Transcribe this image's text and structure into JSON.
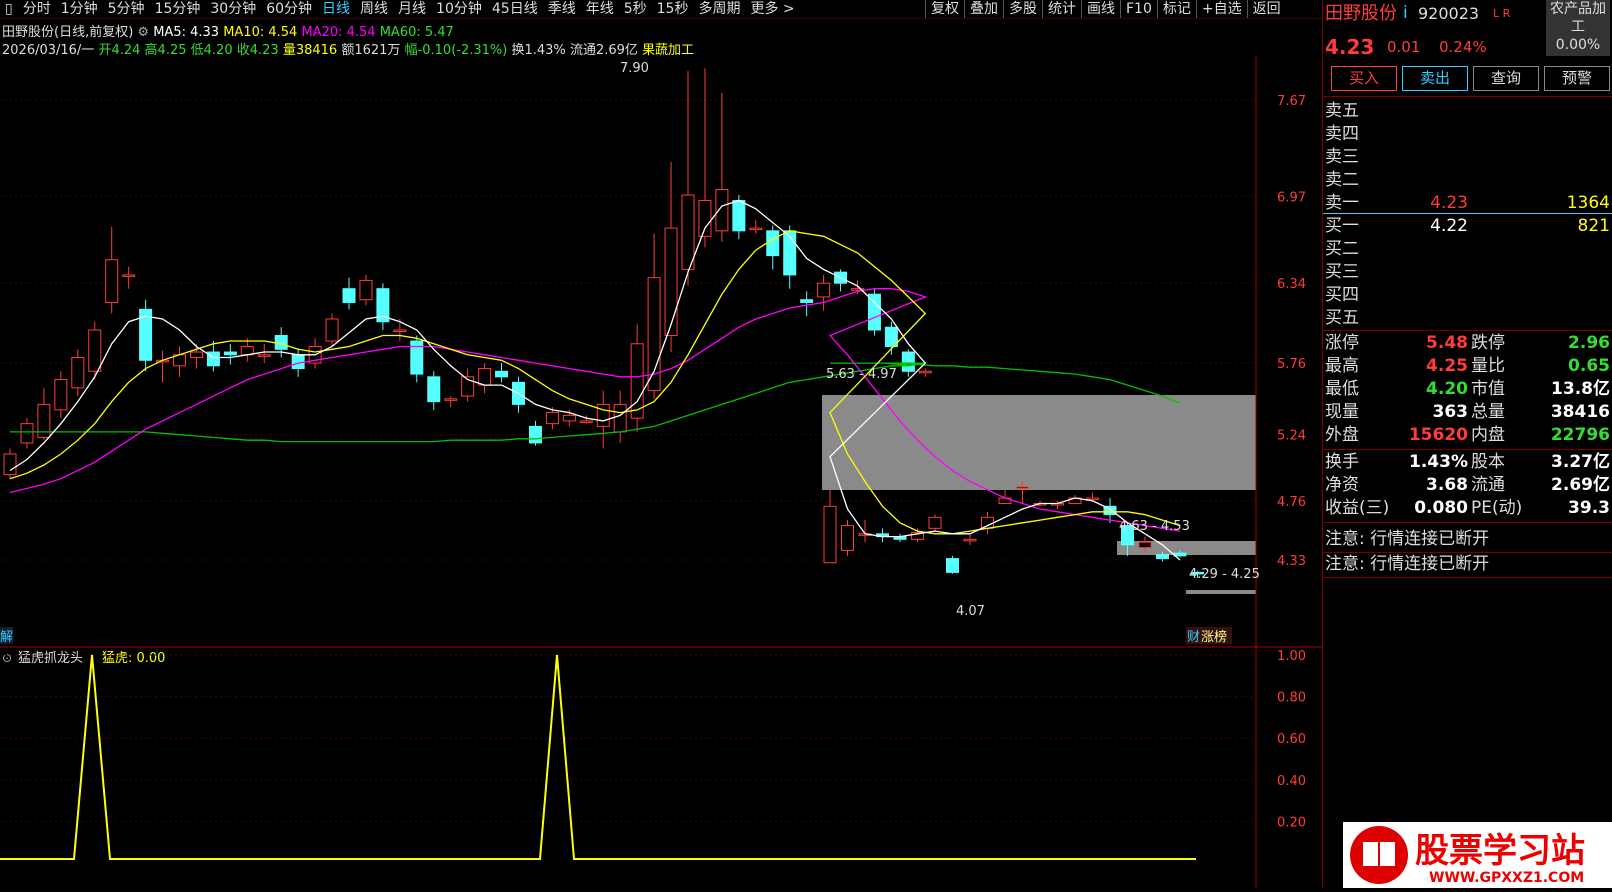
{
  "toolbar": {
    "periods": [
      "分时",
      "1分钟",
      "5分钟",
      "15分钟",
      "30分钟",
      "60分钟",
      "日线",
      "周线",
      "月线",
      "10分钟",
      "45日线",
      "季线",
      "年线",
      "5秒",
      "15秒",
      "多周期",
      "更多 >"
    ],
    "active": "日线",
    "tools": [
      "复权",
      "叠加",
      "多股",
      "统计",
      "画线",
      "F10",
      "标记",
      "+自选",
      "返回"
    ]
  },
  "header": {
    "title": "田野股份(日线,前复权)",
    "ma5": "MA5: 4.33",
    "ma10": "MA10: 4.54",
    "ma20": "MA20: 4.54",
    "ma60": "MA60: 5.47",
    "date": "2026/03/16/一",
    "open": "开4.24",
    "high": "高4.25",
    "low": "低4.20",
    "close": "收4.23",
    "vol": "量38416",
    "amount": "额1621万",
    "change": "幅-0.10(-2.31%)",
    "turnover": "换1.43%",
    "float": "流通2.69亿",
    "sector": "果蔬加工"
  },
  "chart_data": {
    "type": "candlestick",
    "y_ticks": [
      "7.67",
      "6.97",
      "6.34",
      "5.76",
      "5.24",
      "4.76",
      "4.33"
    ],
    "annotations": [
      "7.90",
      "5.63 - 4.97",
      "4.63 - 4.53",
      "4.29 - 4.25",
      "4.07"
    ],
    "bottom_labels": [
      "解",
      "财",
      "涨榜"
    ],
    "indicator": {
      "title": "猛虎抓龙头",
      "value_label": "猛虎: 0.00",
      "y_ticks": [
        "1.00",
        "0.80",
        "0.60",
        "0.40",
        "0.20"
      ],
      "colors": {
        "line": "#ffff00"
      }
    },
    "colors": {
      "up": "#ff3b3b",
      "down": "#54ffff",
      "ma5": "#ffffff",
      "ma10": "#ffff00",
      "ma20": "#ff00ff",
      "ma60": "#00c000"
    }
  },
  "right_panel": {
    "name": "田野股份",
    "code": "920023",
    "flags": "L R",
    "sector": "农产品加工",
    "sector_pct": "0.00%",
    "price": "4.23",
    "chg": "0.01",
    "pct": "0.24%",
    "buttons": [
      "买入",
      "卖出",
      "查询",
      "预警"
    ],
    "asks": [
      {
        "label": "卖五",
        "price": "",
        "vol": ""
      },
      {
        "label": "卖四",
        "price": "",
        "vol": ""
      },
      {
        "label": "卖三",
        "price": "",
        "vol": ""
      },
      {
        "label": "卖二",
        "price": "",
        "vol": ""
      },
      {
        "label": "卖一",
        "price": "4.23",
        "vol": "1364"
      }
    ],
    "bids": [
      {
        "label": "买一",
        "price": "4.22",
        "vol": "821"
      },
      {
        "label": "买二",
        "price": "",
        "vol": ""
      },
      {
        "label": "买三",
        "price": "",
        "vol": ""
      },
      {
        "label": "买四",
        "price": "",
        "vol": ""
      },
      {
        "label": "买五",
        "price": "",
        "vol": ""
      }
    ],
    "stats": [
      {
        "l1": "涨停",
        "v1": "5.48",
        "l2": "跌停",
        "v2": "2.96",
        "c1": "#ff3b3b",
        "c2": "#33dd33"
      },
      {
        "l1": "最高",
        "v1": "4.25",
        "l2": "量比",
        "v2": "0.65",
        "c1": "#ff3b3b",
        "c2": "#33dd33"
      },
      {
        "l1": "最低",
        "v1": "4.20",
        "l2": "市值",
        "v2": "13.8亿",
        "c1": "#33dd33",
        "c2": "#ffffff"
      },
      {
        "l1": "现量",
        "v1": "363",
        "l2": "总量",
        "v2": "38416",
        "c1": "#ffffff",
        "c2": "#ffffff"
      },
      {
        "l1": "外盘",
        "v1": "15620",
        "l2": "内盘",
        "v2": "22796",
        "c1": "#ff3b3b",
        "c2": "#33dd33"
      }
    ],
    "fin": [
      {
        "l1": "换手",
        "v1": "1.43%",
        "l2": "股本",
        "v2": "3.27亿"
      },
      {
        "l1": "净资",
        "v1": "3.68",
        "l2": "流通",
        "v2": "2.69亿"
      },
      {
        "l1": "收益(三)",
        "v1": "0.080",
        "l2": "PE(动)",
        "v2": "39.3"
      }
    ],
    "notices": [
      "注意: 行情连接已断开",
      "注意: 行情连接已断开"
    ]
  },
  "watermark": {
    "text": "股票学习站",
    "url": "WWW.GPXXZ1.COM"
  }
}
